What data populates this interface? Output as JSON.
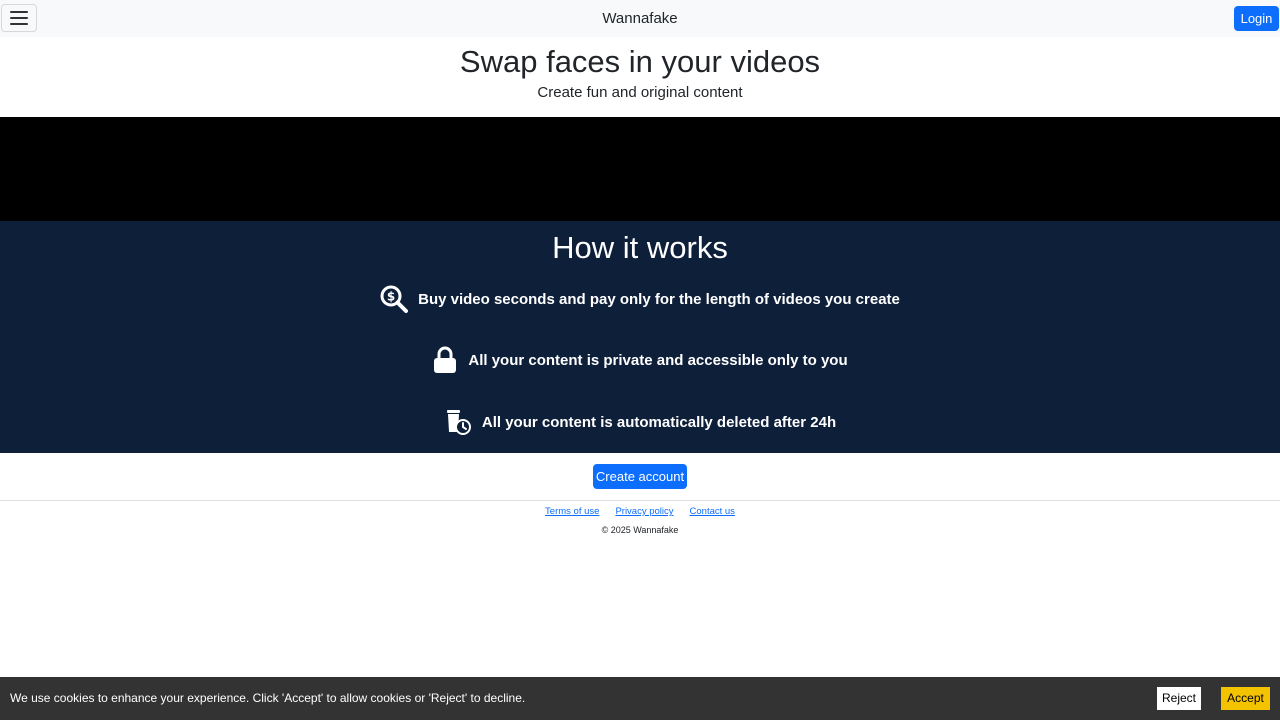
{
  "navbar": {
    "menu_icon": "hamburger-menu-icon",
    "brand": "Wannafake",
    "login_label": "Login"
  },
  "hero": {
    "title": "Swap faces in your videos",
    "subtitle": "Create fun and original content"
  },
  "how_it_works": {
    "title": "How it works",
    "features": [
      {
        "icon": "magnifier-dollar-icon",
        "text": "Buy video seconds and pay only for the length of videos you create"
      },
      {
        "icon": "lock-icon",
        "text": "All your content is private and accessible only to you"
      },
      {
        "icon": "trash-clock-icon",
        "text": "All your content is automatically deleted after 24h"
      }
    ]
  },
  "cta": {
    "create_account_label": "Create account"
  },
  "footer": {
    "links": [
      "Terms of use",
      "Privacy policy",
      "Contact us"
    ],
    "copyright": "© 2025 Wannafake"
  },
  "cookie_banner": {
    "message": "We use cookies to enhance your experience. Click 'Accept' to allow cookies or 'Reject' to decline.",
    "reject_label": "Reject",
    "accept_label": "Accept"
  },
  "colors": {
    "primary": "#0d6efd",
    "how_bg": "#0e1f3a",
    "accept_bg": "#f4c300",
    "cookie_bg": "#333333"
  }
}
